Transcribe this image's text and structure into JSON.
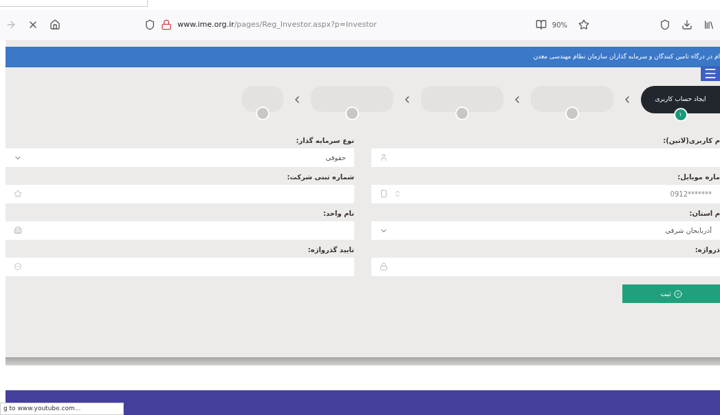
{
  "browser": {
    "url_domain": "www.ime.org.ir",
    "url_path": "/pages/Reg_Investor.aspx?p=Investor",
    "zoom": "90%"
  },
  "header": {
    "title": "ام در درگاه تامین کنندگان و سرمایه گذاران سازمان نظام مهندسی معدن"
  },
  "steps": [
    {
      "label": "ایجاد حساب کاربری",
      "number": "۱",
      "selected": true
    },
    {
      "selected": false
    },
    {
      "selected": false
    },
    {
      "selected": false
    },
    {
      "selected": false
    }
  ],
  "form": {
    "fields": [
      {
        "label": "م کاربری(لاتین):",
        "kind": "input"
      },
      {
        "label": "نوع سرمایه گذار:",
        "kind": "select",
        "value": "حقوقی"
      },
      {
        "label": "ماره موبایل:",
        "kind": "input",
        "placeholder": "0912*******"
      },
      {
        "label": "شماره ثبتی شرکت:",
        "kind": "input"
      },
      {
        "label": "م استان:",
        "kind": "select",
        "value": "آذربایجان شرقی"
      },
      {
        "label": "نام واحد:",
        "kind": "input"
      },
      {
        "label": "ذرواژه:",
        "kind": "input"
      },
      {
        "label": "تایید گذرواژه:",
        "kind": "input"
      }
    ],
    "submit": "ثبت"
  },
  "status_bar": {
    "text": "g to www.youtube.com..."
  }
}
